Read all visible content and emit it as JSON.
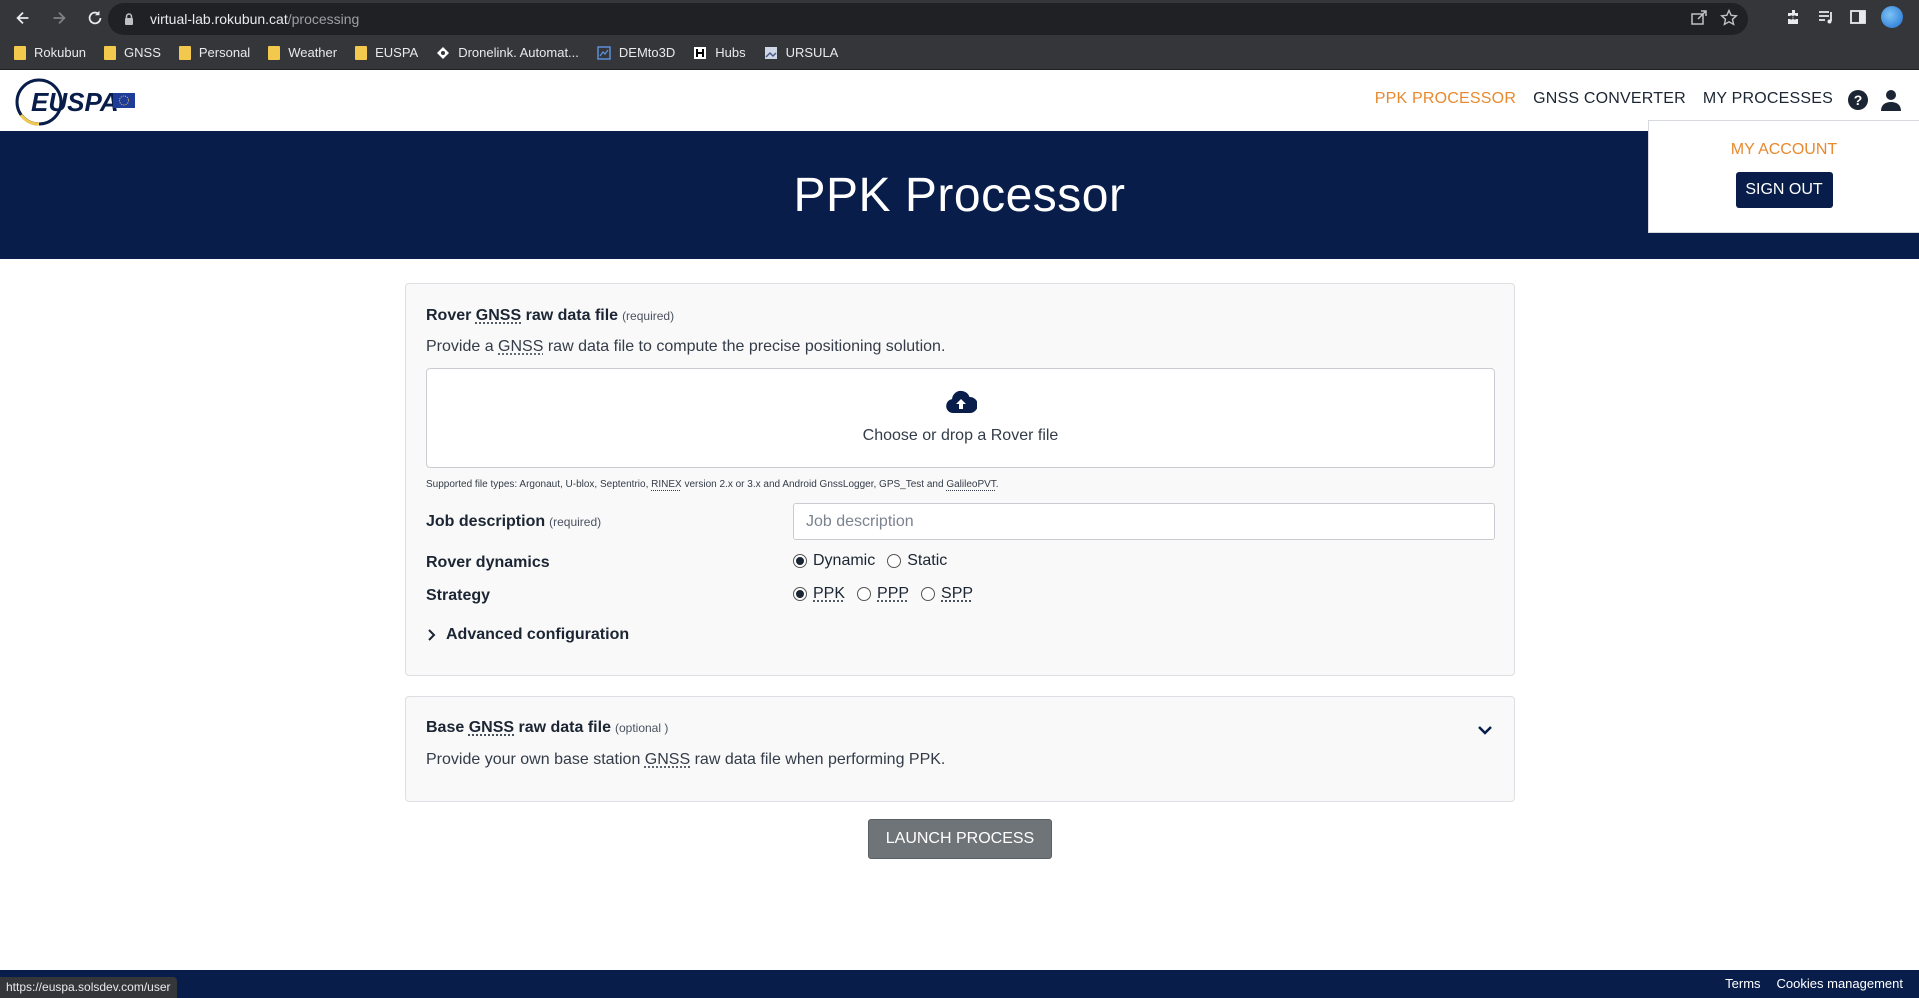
{
  "browser": {
    "url_host": "virtual-lab.rokubun.cat",
    "url_path": "/processing",
    "bookmarks": [
      {
        "label": "Rokubun",
        "type": "folder"
      },
      {
        "label": "GNSS",
        "type": "folder"
      },
      {
        "label": "Personal",
        "type": "folder"
      },
      {
        "label": "Weather",
        "type": "folder"
      },
      {
        "label": "EUSPA",
        "type": "folder"
      },
      {
        "label": "Dronelink. Automat...",
        "type": "site"
      },
      {
        "label": "DEMto3D",
        "type": "site"
      },
      {
        "label": "Hubs",
        "type": "site"
      },
      {
        "label": "URSULA",
        "type": "site"
      }
    ],
    "status_url": "https://euspa.solsdev.com/user"
  },
  "header": {
    "nav": [
      {
        "label": "PPK PROCESSOR",
        "active": true
      },
      {
        "label": "GNSS CONVERTER",
        "active": false
      },
      {
        "label": "MY PROCESSES",
        "active": false
      }
    ]
  },
  "hero": {
    "title": "PPK Processor"
  },
  "account_menu": {
    "my_account": "MY ACCOUNT",
    "sign_out": "SIGN OUT"
  },
  "rover": {
    "title_prefix": "Rover ",
    "title_abbr": "GNSS",
    "title_suffix": " raw data file",
    "required": "(required)",
    "desc_prefix": "Provide a ",
    "desc_abbr": "GNSS",
    "desc_suffix": " raw data file to compute the precise positioning solution.",
    "drop_text": "Choose or drop a Rover file",
    "supported_prefix": "Supported file types: Argonaut, U-blox, Septentrio, ",
    "supported_abbr1": "RINEX",
    "supported_middle": " version 2.x or 3.x and Android GnssLogger, GPS_Test and ",
    "supported_abbr2": "GalileoPVT",
    "supported_suffix": "."
  },
  "form": {
    "job_label": "Job description",
    "job_required": "(required)",
    "job_placeholder": "Job description",
    "dynamics_label": "Rover dynamics",
    "dynamics_options": [
      "Dynamic",
      "Static"
    ],
    "dynamics_selected": "Dynamic",
    "strategy_label": "Strategy",
    "strategy_options": [
      "PPK",
      "PPP",
      "SPP"
    ],
    "strategy_selected": "PPK",
    "advanced": "Advanced configuration"
  },
  "base": {
    "title_prefix": "Base ",
    "title_abbr": "GNSS",
    "title_suffix": " raw data file",
    "optional": "(optional )",
    "desc_prefix": "Provide your own base station ",
    "desc_abbr": "GNSS",
    "desc_suffix": " raw data file when performing PPK."
  },
  "launch": "LAUNCH PROCESS",
  "footer": {
    "terms": "Terms",
    "cookies": "Cookies management"
  },
  "colors": {
    "navy": "#081d4a",
    "accent": "#e8892f"
  }
}
